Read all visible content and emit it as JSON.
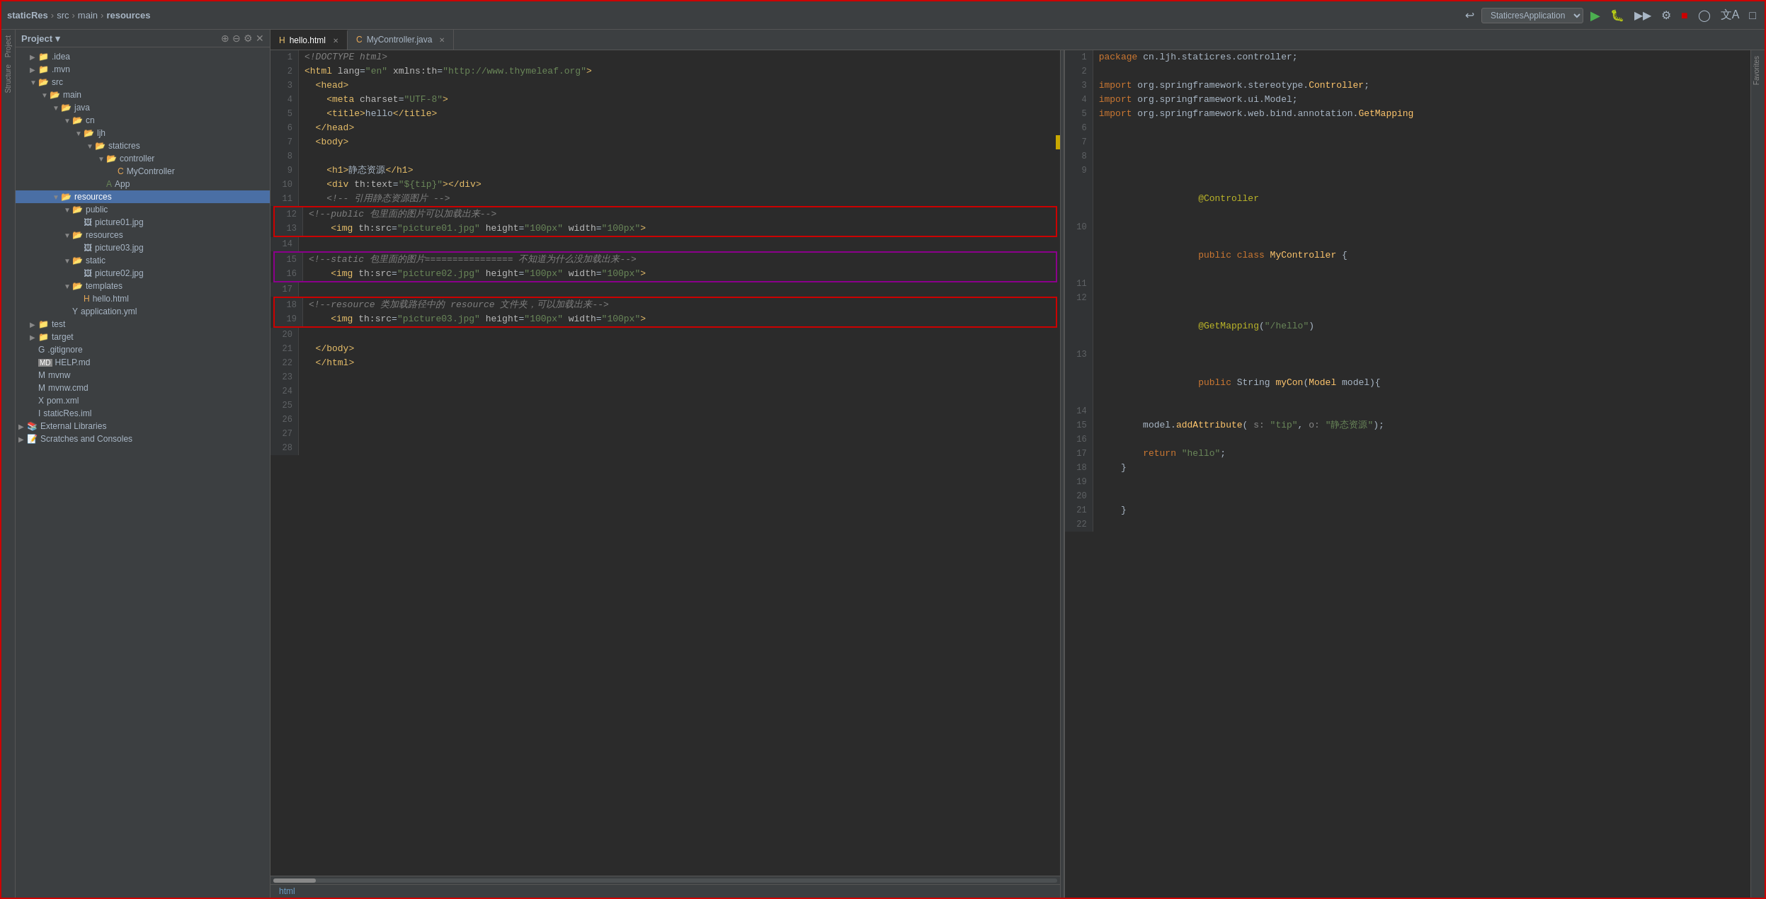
{
  "topbar": {
    "breadcrumb": [
      "staticRes",
      "src",
      "main",
      "resources"
    ],
    "app_name": "StaticresApplication",
    "breadcrumb_sep": "›"
  },
  "project_panel": {
    "title": "Project",
    "tree": [
      {
        "id": "idea",
        "label": ".idea",
        "type": "folder",
        "depth": 1,
        "open": false
      },
      {
        "id": "mvn",
        "label": ".mvn",
        "type": "folder",
        "depth": 1,
        "open": false
      },
      {
        "id": "src",
        "label": "src",
        "type": "folder",
        "depth": 1,
        "open": true
      },
      {
        "id": "main",
        "label": "main",
        "type": "folder",
        "depth": 2,
        "open": true
      },
      {
        "id": "java",
        "label": "java",
        "type": "folder",
        "depth": 3,
        "open": true
      },
      {
        "id": "cn",
        "label": "cn",
        "type": "folder",
        "depth": 4,
        "open": true
      },
      {
        "id": "ljh",
        "label": "ljh",
        "type": "folder",
        "depth": 5,
        "open": true
      },
      {
        "id": "staticres",
        "label": "staticres",
        "type": "folder",
        "depth": 6,
        "open": true
      },
      {
        "id": "controller",
        "label": "controller",
        "type": "folder",
        "depth": 7,
        "open": true
      },
      {
        "id": "mycontroller",
        "label": "MyController",
        "type": "java",
        "depth": 8
      },
      {
        "id": "app",
        "label": "App",
        "type": "java_app",
        "depth": 7
      },
      {
        "id": "resources",
        "label": "resources",
        "type": "folder_selected",
        "depth": 3,
        "open": true
      },
      {
        "id": "public",
        "label": "public",
        "type": "folder",
        "depth": 4,
        "open": true
      },
      {
        "id": "picture01",
        "label": "picture01.jpg",
        "type": "image",
        "depth": 5
      },
      {
        "id": "resources2",
        "label": "resources",
        "type": "folder",
        "depth": 4,
        "open": true
      },
      {
        "id": "picture03",
        "label": "picture03.jpg",
        "type": "image",
        "depth": 5
      },
      {
        "id": "static",
        "label": "static",
        "type": "folder",
        "depth": 4,
        "open": true
      },
      {
        "id": "picture02",
        "label": "picture02.jpg",
        "type": "image",
        "depth": 5
      },
      {
        "id": "templates",
        "label": "templates",
        "type": "folder",
        "depth": 4,
        "open": true
      },
      {
        "id": "hello",
        "label": "hello.html",
        "type": "html",
        "depth": 5
      },
      {
        "id": "application",
        "label": "application.yml",
        "type": "yml",
        "depth": 4
      },
      {
        "id": "test",
        "label": "test",
        "type": "folder",
        "depth": 1,
        "open": false
      },
      {
        "id": "target",
        "label": "target",
        "type": "folder_yellow",
        "depth": 1,
        "open": false
      },
      {
        "id": "gitignore",
        "label": ".gitignore",
        "type": "file",
        "depth": 1
      },
      {
        "id": "helpmd",
        "label": "HELP.md",
        "type": "md",
        "depth": 1
      },
      {
        "id": "mvnw",
        "label": "mvnw",
        "type": "file",
        "depth": 1
      },
      {
        "id": "mvnwcmd",
        "label": "mvnw.cmd",
        "type": "file",
        "depth": 1
      },
      {
        "id": "pomxml",
        "label": "pom.xml",
        "type": "xml",
        "depth": 1
      },
      {
        "id": "staticiml",
        "label": "staticRes.iml",
        "type": "iml",
        "depth": 1
      },
      {
        "id": "extlibs",
        "label": "External Libraries",
        "type": "ext",
        "depth": 0
      },
      {
        "id": "scratches",
        "label": "Scratches and Consoles",
        "type": "scratch",
        "depth": 0
      }
    ]
  },
  "editor_left": {
    "tab_name": "hello.html",
    "lines": [
      {
        "num": 1,
        "content": "<!DOCTYPE html>"
      },
      {
        "num": 2,
        "content": "<html lang=\"en\" xmlns:th=\"http://www.thymeleaf.org\">"
      },
      {
        "num": 3,
        "content": "  <head>"
      },
      {
        "num": 4,
        "content": "    <meta charset=\"UTF-8\">"
      },
      {
        "num": 5,
        "content": "    <title>hello</title>"
      },
      {
        "num": 6,
        "content": "  </head>"
      },
      {
        "num": 7,
        "content": "  <body>"
      },
      {
        "num": 8,
        "content": ""
      },
      {
        "num": 9,
        "content": "    <h1>静态资源</h1>"
      },
      {
        "num": 10,
        "content": "    <div th:text=\"${tip}\"></div>"
      },
      {
        "num": 11,
        "content": "    <!-- 引用静态资源图片 -->"
      },
      {
        "num": 12,
        "content": "    <!--public 包里面的图片可以加载出来-->"
      },
      {
        "num": 13,
        "content": "    <img th:src=\"picture01.jpg\" height=\"100px\" width=\"100px\">"
      },
      {
        "num": 14,
        "content": ""
      },
      {
        "num": 15,
        "content": "    <!--static 包里面的图片================ 不知道为什么没加载出来-->"
      },
      {
        "num": 16,
        "content": "    <img th:src=\"picture02.jpg\" height=\"100px\" width=\"100px\">"
      },
      {
        "num": 17,
        "content": ""
      },
      {
        "num": 18,
        "content": "    <!--resource 类加载路径中的 resource 文件夹，可以加载出来-->"
      },
      {
        "num": 19,
        "content": "    <img th:src=\"picture03.jpg\" height=\"100px\" width=\"100px\">"
      },
      {
        "num": 20,
        "content": ""
      },
      {
        "num": 21,
        "content": "  </body>"
      },
      {
        "num": 22,
        "content": "  </html>"
      },
      {
        "num": 23,
        "content": ""
      },
      {
        "num": 24,
        "content": ""
      },
      {
        "num": 25,
        "content": ""
      },
      {
        "num": 26,
        "content": ""
      },
      {
        "num": 27,
        "content": ""
      },
      {
        "num": 28,
        "content": ""
      }
    ]
  },
  "editor_right": {
    "tab_name": "MyController.java",
    "lines": [
      {
        "num": 1,
        "content": "package cn.ljh.staticres.controller;"
      },
      {
        "num": 2,
        "content": ""
      },
      {
        "num": 3,
        "content": "import org.springframework.stereotype.Controller;"
      },
      {
        "num": 4,
        "content": "import org.springframework.ui.Model;"
      },
      {
        "num": 5,
        "content": "import org.springframework.web.bind.annotation.GetMapping"
      },
      {
        "num": 6,
        "content": ""
      },
      {
        "num": 7,
        "content": ""
      },
      {
        "num": 8,
        "content": ""
      },
      {
        "num": 9,
        "content": "@Controller"
      },
      {
        "num": 10,
        "content": "public class MyController {"
      },
      {
        "num": 11,
        "content": ""
      },
      {
        "num": 12,
        "content": "    @GetMapping(\"/hello\")"
      },
      {
        "num": 13,
        "content": "    public String myCon(Model model){"
      },
      {
        "num": 14,
        "content": ""
      },
      {
        "num": 15,
        "content": "        model.addAttribute( s: \"tip\", o: \"静态资源\");"
      },
      {
        "num": 16,
        "content": ""
      },
      {
        "num": 17,
        "content": "        return \"hello\";"
      },
      {
        "num": 18,
        "content": "    }"
      },
      {
        "num": 19,
        "content": ""
      },
      {
        "num": 20,
        "content": ""
      },
      {
        "num": 21,
        "content": "    }"
      },
      {
        "num": 22,
        "content": ""
      }
    ]
  },
  "bottom": {
    "tab": "html"
  },
  "colors": {
    "selected_bg": "#4a6fa5",
    "editor_bg": "#2b2b2b",
    "panel_bg": "#3c3f41",
    "red_border": "#cc0000",
    "purple_border": "#8b008b"
  }
}
